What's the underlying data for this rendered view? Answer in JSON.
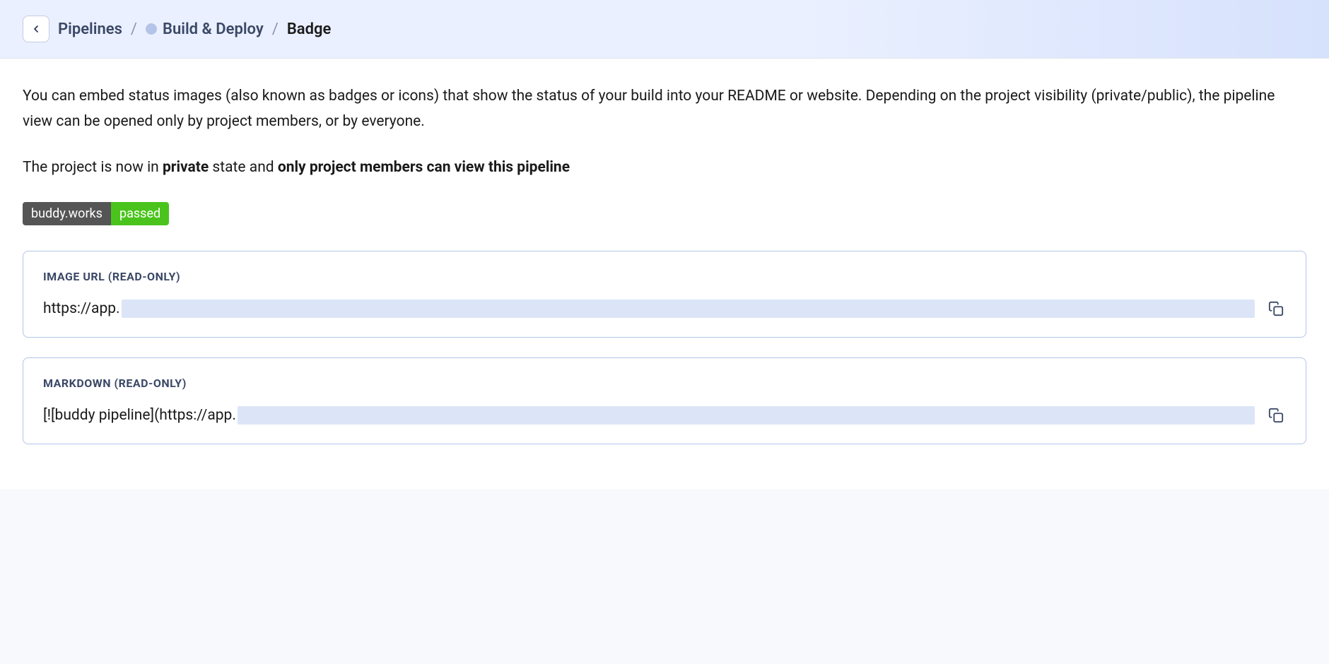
{
  "breadcrumb": {
    "item1": "Pipelines",
    "item2": "Build & Deploy",
    "item3": "Badge"
  },
  "description": "You can embed status images (also known as badges or icons) that show the status of your build into your README or website. Depending on the project visibility (private/public), the pipeline view can be opened only by project members, or by everyone.",
  "visibility": {
    "prefix": "The project is now in ",
    "state": "private",
    "middle": " state and ",
    "restriction": "only project members can view this pipeline"
  },
  "badge": {
    "service": "buddy.works",
    "status": "passed"
  },
  "fields": {
    "image_url": {
      "label": "IMAGE URL (READ-ONLY)",
      "value": "https://app."
    },
    "markdown": {
      "label": "MARKDOWN (READ-ONLY)",
      "value": "[![buddy pipeline](https://app."
    }
  }
}
